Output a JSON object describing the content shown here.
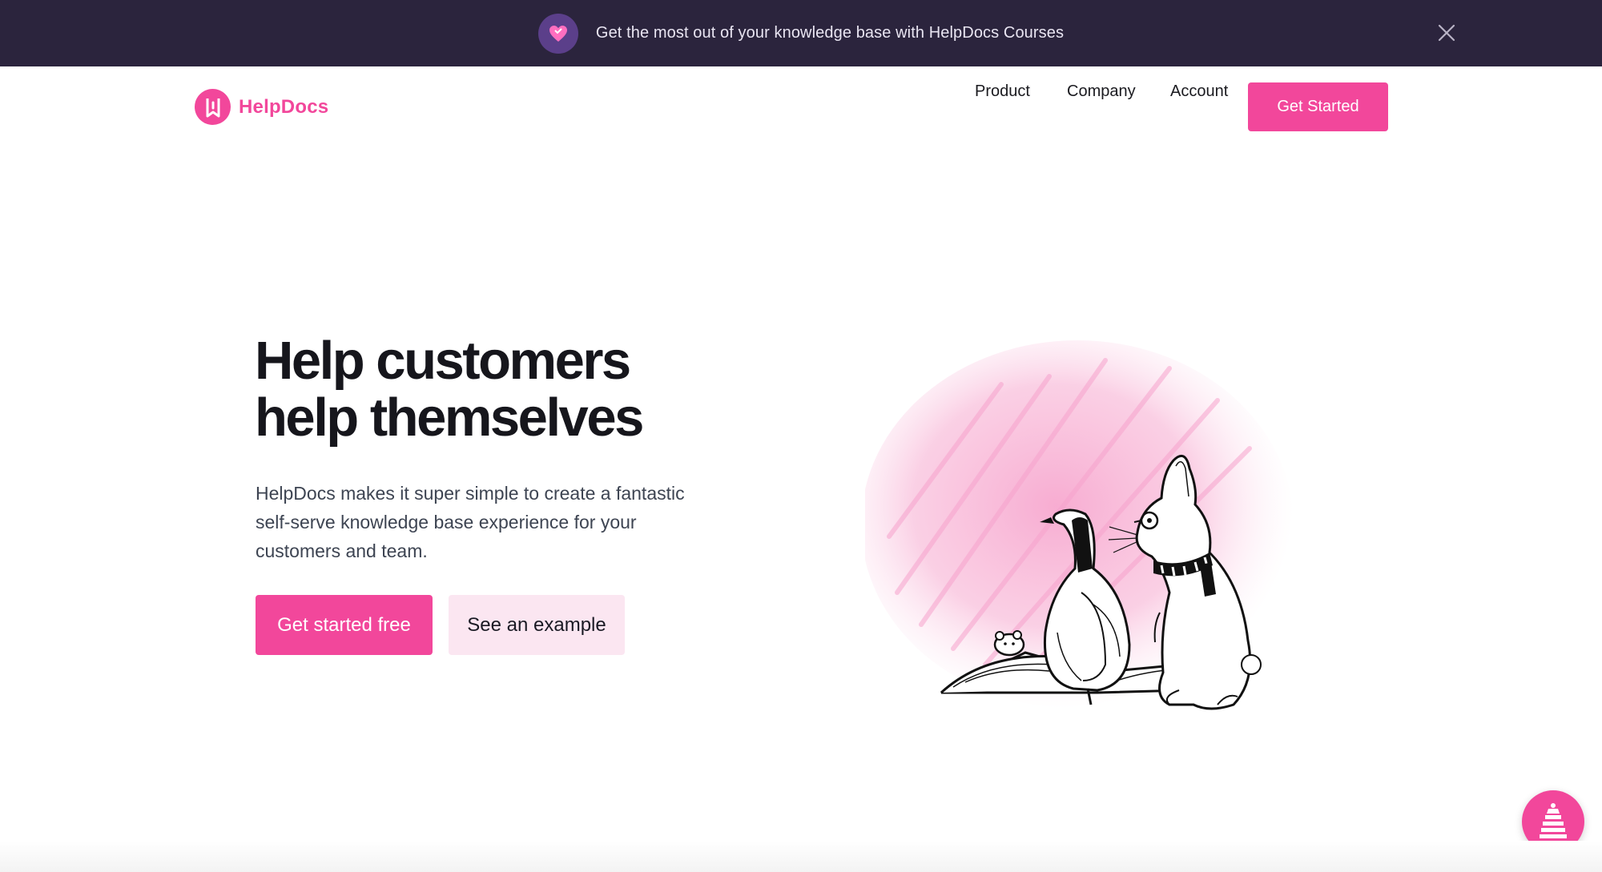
{
  "announcement": {
    "text": "Get the most out of your knowledge base with HelpDocs Courses",
    "icon": "heart-icon",
    "close_icon": "close-icon"
  },
  "header": {
    "logo_text": "HelpDocs",
    "nav": {
      "product": "Product",
      "company": "Company",
      "account": "Account"
    },
    "cta_label": "Get Started"
  },
  "hero": {
    "title_line1": "Help customers",
    "title_line2": "help themselves",
    "subtitle": "HelpDocs makes it super simple to create a fantastic self-serve knowledge base experience for your customers and team.",
    "primary_button": "Get started free",
    "secondary_button": "See an example"
  },
  "colors": {
    "brand_pink": "#f2479b",
    "announcement_bg": "#2b243d",
    "secondary_button_bg": "#fbe6f1"
  }
}
